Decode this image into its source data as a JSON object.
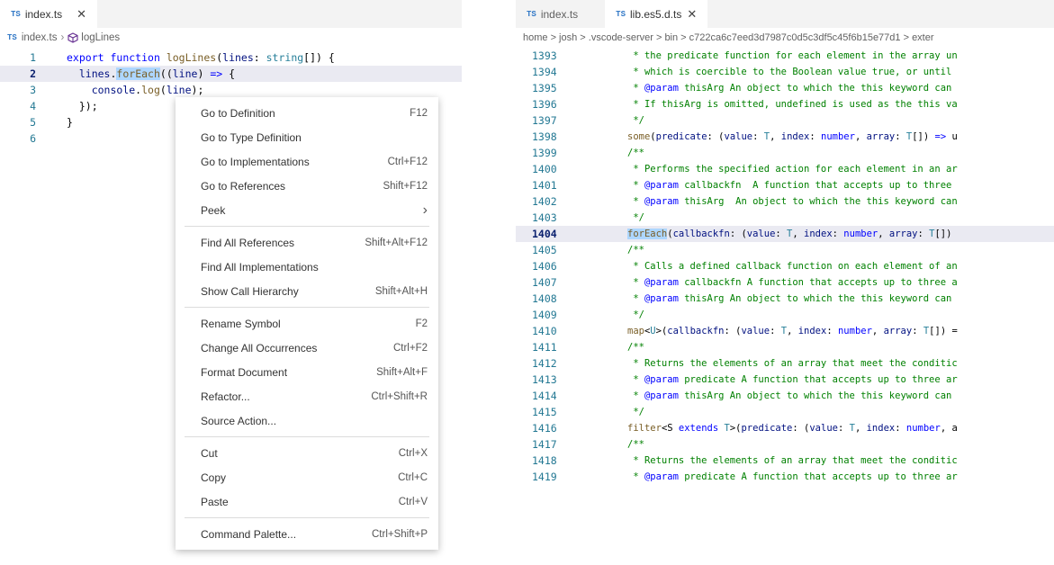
{
  "left": {
    "tab": {
      "badge": "TS",
      "label": "index.ts",
      "close": "✕"
    },
    "breadcrumb": {
      "file": "index.ts",
      "symbol": "logLines"
    },
    "lines": [
      "1",
      "2",
      "3",
      "4",
      "5",
      "6"
    ]
  },
  "right": {
    "tabs": [
      {
        "badge": "TS",
        "label": "index.ts"
      },
      {
        "badge": "TS",
        "label": "lib.es5.d.ts",
        "close": "✕"
      }
    ],
    "breadcrumb": "home > josh > .vscode-server > bin > c722ca6c7eed3d7987c0d5c3df5c45f6b15e77d1 > exter",
    "lines": [
      {
        "n": "1393",
        "t": " * the predicate function for each element in the array un"
      },
      {
        "n": "1394",
        "t": " * which is coercible to the Boolean value true, or until"
      },
      {
        "n": "1395",
        "t": " * @param thisArg An object to which the this keyword can"
      },
      {
        "n": "1396",
        "t": " * If thisArg is omitted, undefined is used as the this va"
      },
      {
        "n": "1397",
        "t": " */"
      },
      {
        "n": "1398",
        "t": "some(predicate: (value: T, index: number, array: T[]) => u"
      },
      {
        "n": "1399",
        "t": "/**"
      },
      {
        "n": "1400",
        "t": " * Performs the specified action for each element in an ar"
      },
      {
        "n": "1401",
        "t": " * @param callbackfn  A function that accepts up to three"
      },
      {
        "n": "1402",
        "t": " * @param thisArg  An object to which the this keyword can"
      },
      {
        "n": "1403",
        "t": " */"
      },
      {
        "n": "1404",
        "t": "forEach(callbackfn: (value: T, index: number, array: T[])"
      },
      {
        "n": "1405",
        "t": "/**"
      },
      {
        "n": "1406",
        "t": " * Calls a defined callback function on each element of an"
      },
      {
        "n": "1407",
        "t": " * @param callbackfn A function that accepts up to three a"
      },
      {
        "n": "1408",
        "t": " * @param thisArg An object to which the this keyword can"
      },
      {
        "n": "1409",
        "t": " */"
      },
      {
        "n": "1410",
        "t": "map<U>(callbackfn: (value: T, index: number, array: T[]) ="
      },
      {
        "n": "1411",
        "t": "/**"
      },
      {
        "n": "1412",
        "t": " * Returns the elements of an array that meet the conditic"
      },
      {
        "n": "1413",
        "t": " * @param predicate A function that accepts up to three ar"
      },
      {
        "n": "1414",
        "t": " * @param thisArg An object to which the this keyword can"
      },
      {
        "n": "1415",
        "t": " */"
      },
      {
        "n": "1416",
        "t": "filter<S extends T>(predicate: (value: T, index: number, a"
      },
      {
        "n": "1417",
        "t": "/**"
      },
      {
        "n": "1418",
        "t": " * Returns the elements of an array that meet the conditic"
      },
      {
        "n": "1419",
        "t": " * @param predicate A function that accepts up to three ar"
      }
    ]
  },
  "menu": [
    [
      {
        "label": "Go to Definition",
        "key": "F12"
      },
      {
        "label": "Go to Type Definition",
        "key": ""
      },
      {
        "label": "Go to Implementations",
        "key": "Ctrl+F12"
      },
      {
        "label": "Go to References",
        "key": "Shift+F12"
      },
      {
        "label": "Peek",
        "key": "›"
      }
    ],
    [
      {
        "label": "Find All References",
        "key": "Shift+Alt+F12"
      },
      {
        "label": "Find All Implementations",
        "key": ""
      },
      {
        "label": "Show Call Hierarchy",
        "key": "Shift+Alt+H"
      }
    ],
    [
      {
        "label": "Rename Symbol",
        "key": "F2"
      },
      {
        "label": "Change All Occurrences",
        "key": "Ctrl+F2"
      },
      {
        "label": "Format Document",
        "key": "Shift+Alt+F"
      },
      {
        "label": "Refactor...",
        "key": "Ctrl+Shift+R"
      },
      {
        "label": "Source Action...",
        "key": ""
      }
    ],
    [
      {
        "label": "Cut",
        "key": "Ctrl+X"
      },
      {
        "label": "Copy",
        "key": "Ctrl+C"
      },
      {
        "label": "Paste",
        "key": "Ctrl+V"
      }
    ],
    [
      {
        "label": "Command Palette...",
        "key": "Ctrl+Shift+P"
      }
    ]
  ],
  "colors": {
    "keyword": "#0000ff",
    "function": "#795e26",
    "comment": "#008000",
    "type": "#267f99",
    "selection": "#add6ff"
  },
  "icons": {
    "close": "close-icon",
    "symbol": "cube-icon"
  }
}
